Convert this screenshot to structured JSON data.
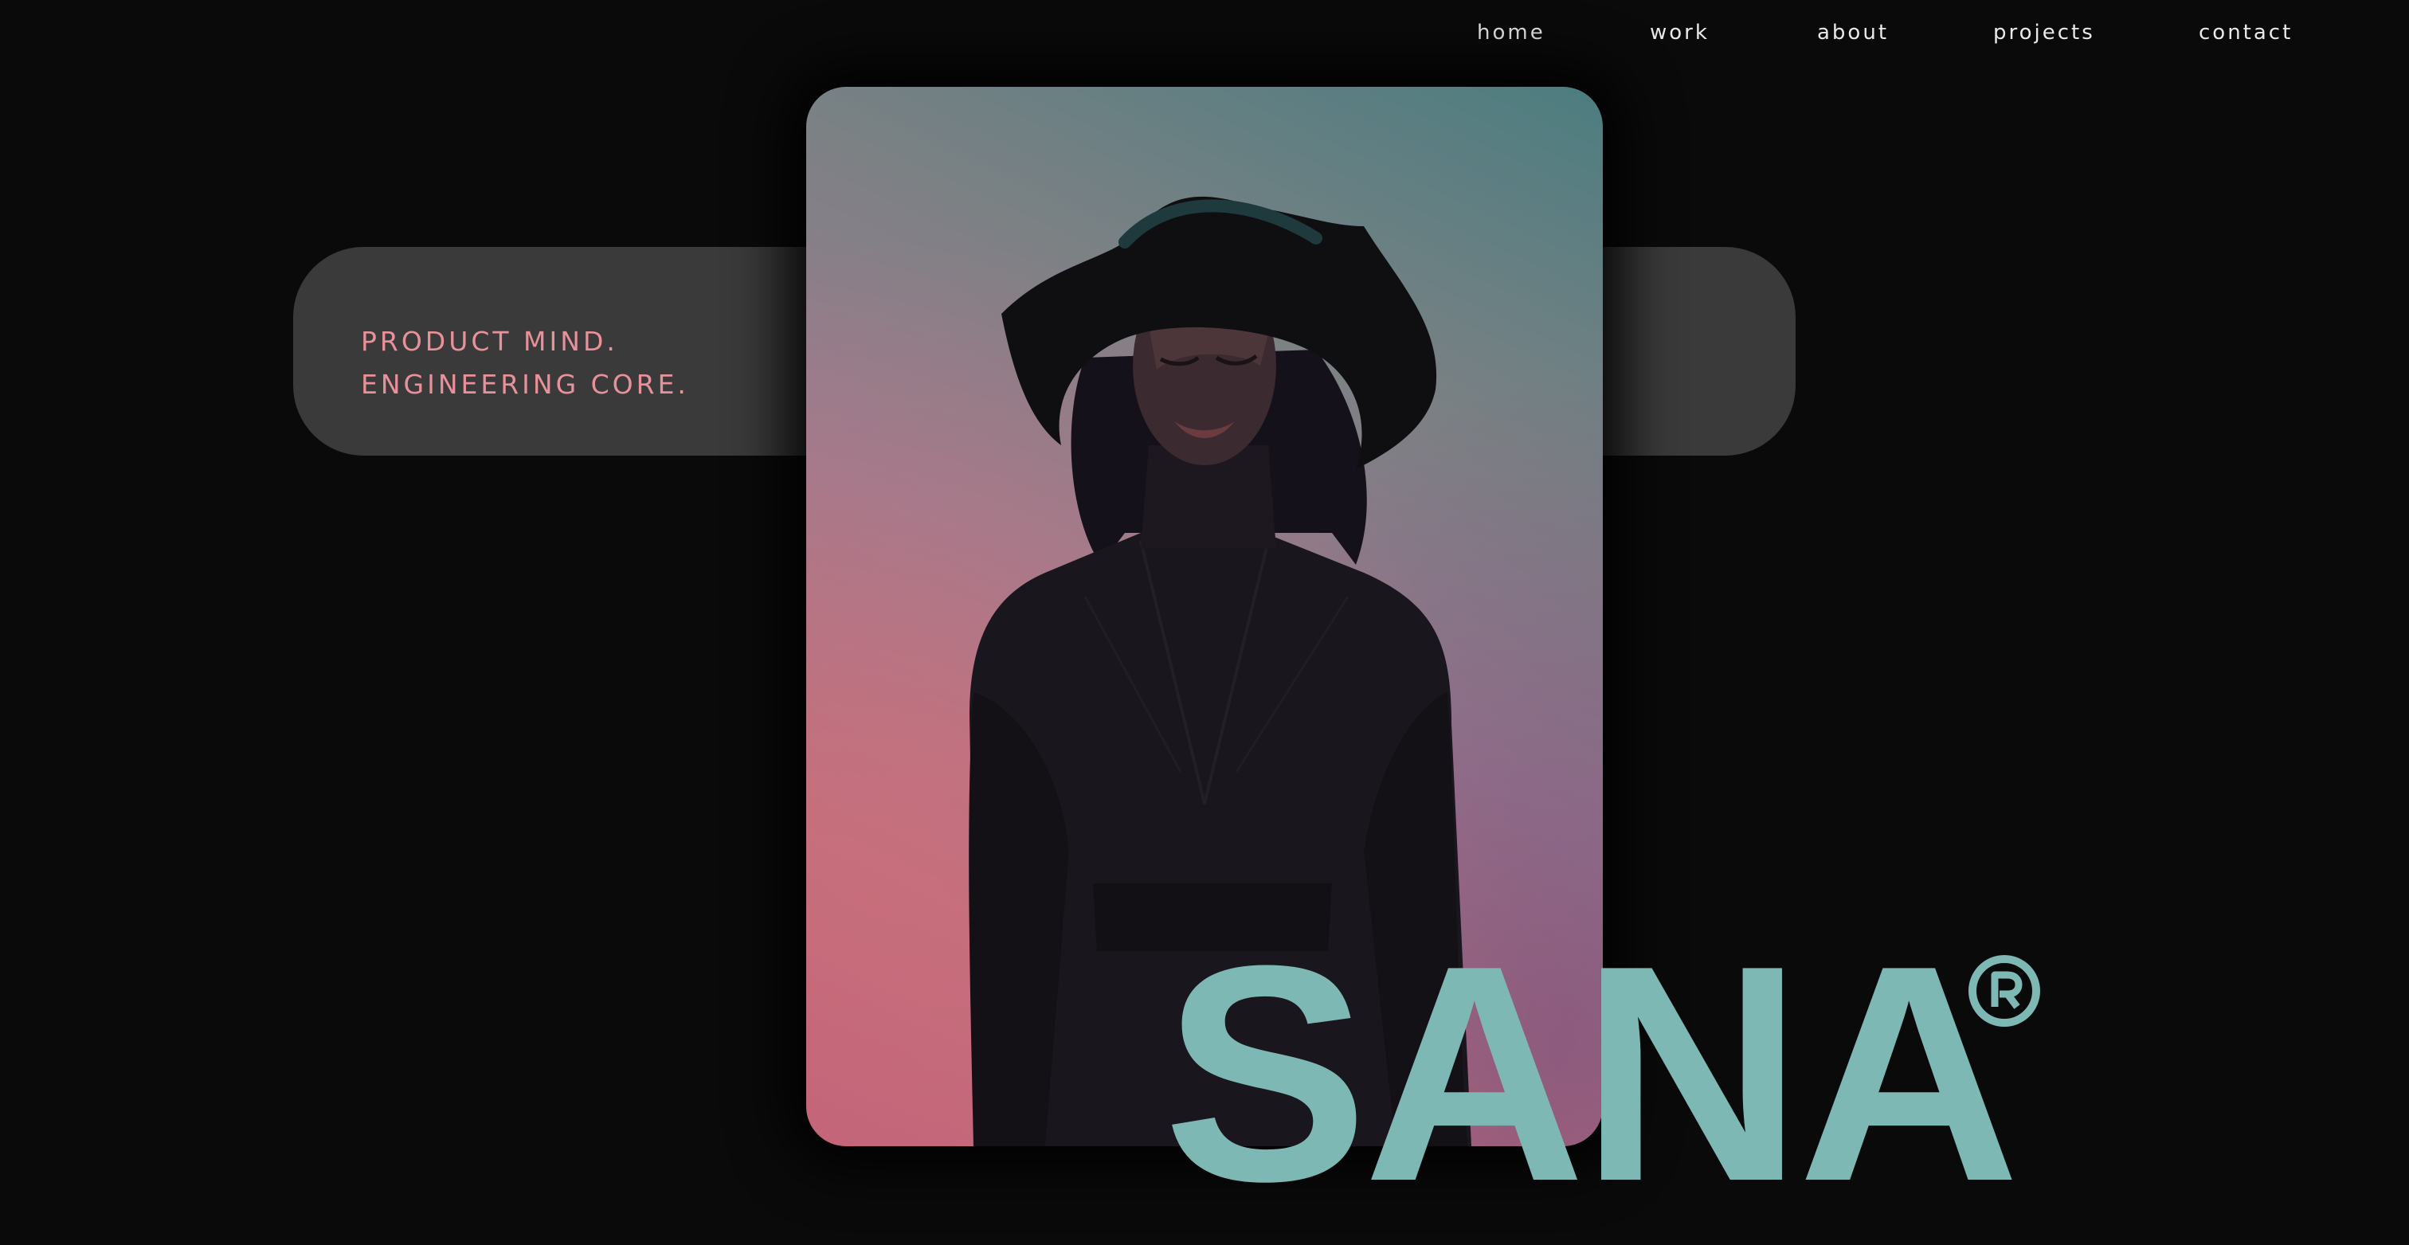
{
  "nav": {
    "items": [
      {
        "label": "home"
      },
      {
        "label": "work"
      },
      {
        "label": "about"
      },
      {
        "label": "projects"
      },
      {
        "label": "contact"
      }
    ]
  },
  "hero": {
    "tagline_line1": "PRODUCT MIND.",
    "tagline_line2": "ENGINEERING CORE.",
    "brand": "SANA",
    "registered_mark": "®"
  },
  "colors": {
    "background": "#0a0a0a",
    "pill": "#3a3a3a",
    "tagline": "#e8919a",
    "brand": "#7eb8b4",
    "nav_text": "#e9e9e9"
  },
  "icons": [
    "registered-trademark-icon"
  ]
}
